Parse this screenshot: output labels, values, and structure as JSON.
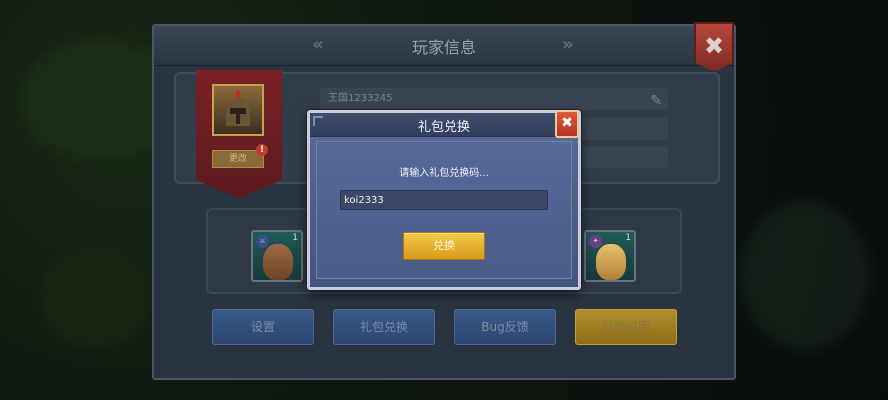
{
  "window": {
    "title": "玩家信息",
    "prev_arrow": "«",
    "next_arrow": "»",
    "close_glyph": "✖"
  },
  "profile": {
    "kingdom_label": "王国1233245",
    "portrait_button": "更改",
    "alert_glyph": "!",
    "edit_icon": "✎"
  },
  "heroes": [
    {
      "level": "1"
    },
    {
      "level": "1"
    }
  ],
  "bottom_buttons": {
    "settings": "设置",
    "gift_redeem": "礼包兑换",
    "bug_feedback": "Bug反馈",
    "help": "帮助说明"
  },
  "dialog": {
    "title": "礼包兑换",
    "close_glyph": "✖",
    "prompt": "请输入礼包兑换码...",
    "code_value": "koi2333",
    "redeem_button": "兑换"
  },
  "colors": {
    "accent_gold": "#f4c94c",
    "close_red": "#d9472f",
    "dialog_blue": "#4e6190"
  }
}
